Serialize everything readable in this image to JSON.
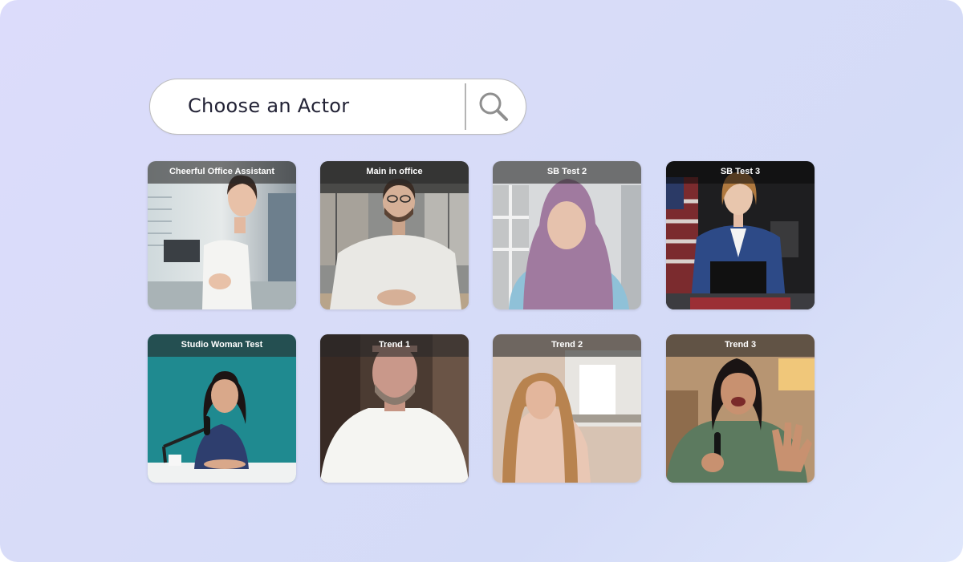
{
  "search": {
    "placeholder": "Choose an Actor",
    "icon": "search-icon"
  },
  "actors": [
    {
      "title": "Cheerful Office Assistant"
    },
    {
      "title": "Main in office"
    },
    {
      "title": "SB Test 2"
    },
    {
      "title": "SB Test 3"
    },
    {
      "title": "Studio Woman Test"
    },
    {
      "title": "Trend 1"
    },
    {
      "title": "Trend 2"
    },
    {
      "title": "Trend 3"
    }
  ],
  "colors": {
    "background_start": "#dcdcfb",
    "background_end": "#dfe6fb",
    "search_border": "#bdbdbd",
    "label_overlay": "#282828"
  }
}
